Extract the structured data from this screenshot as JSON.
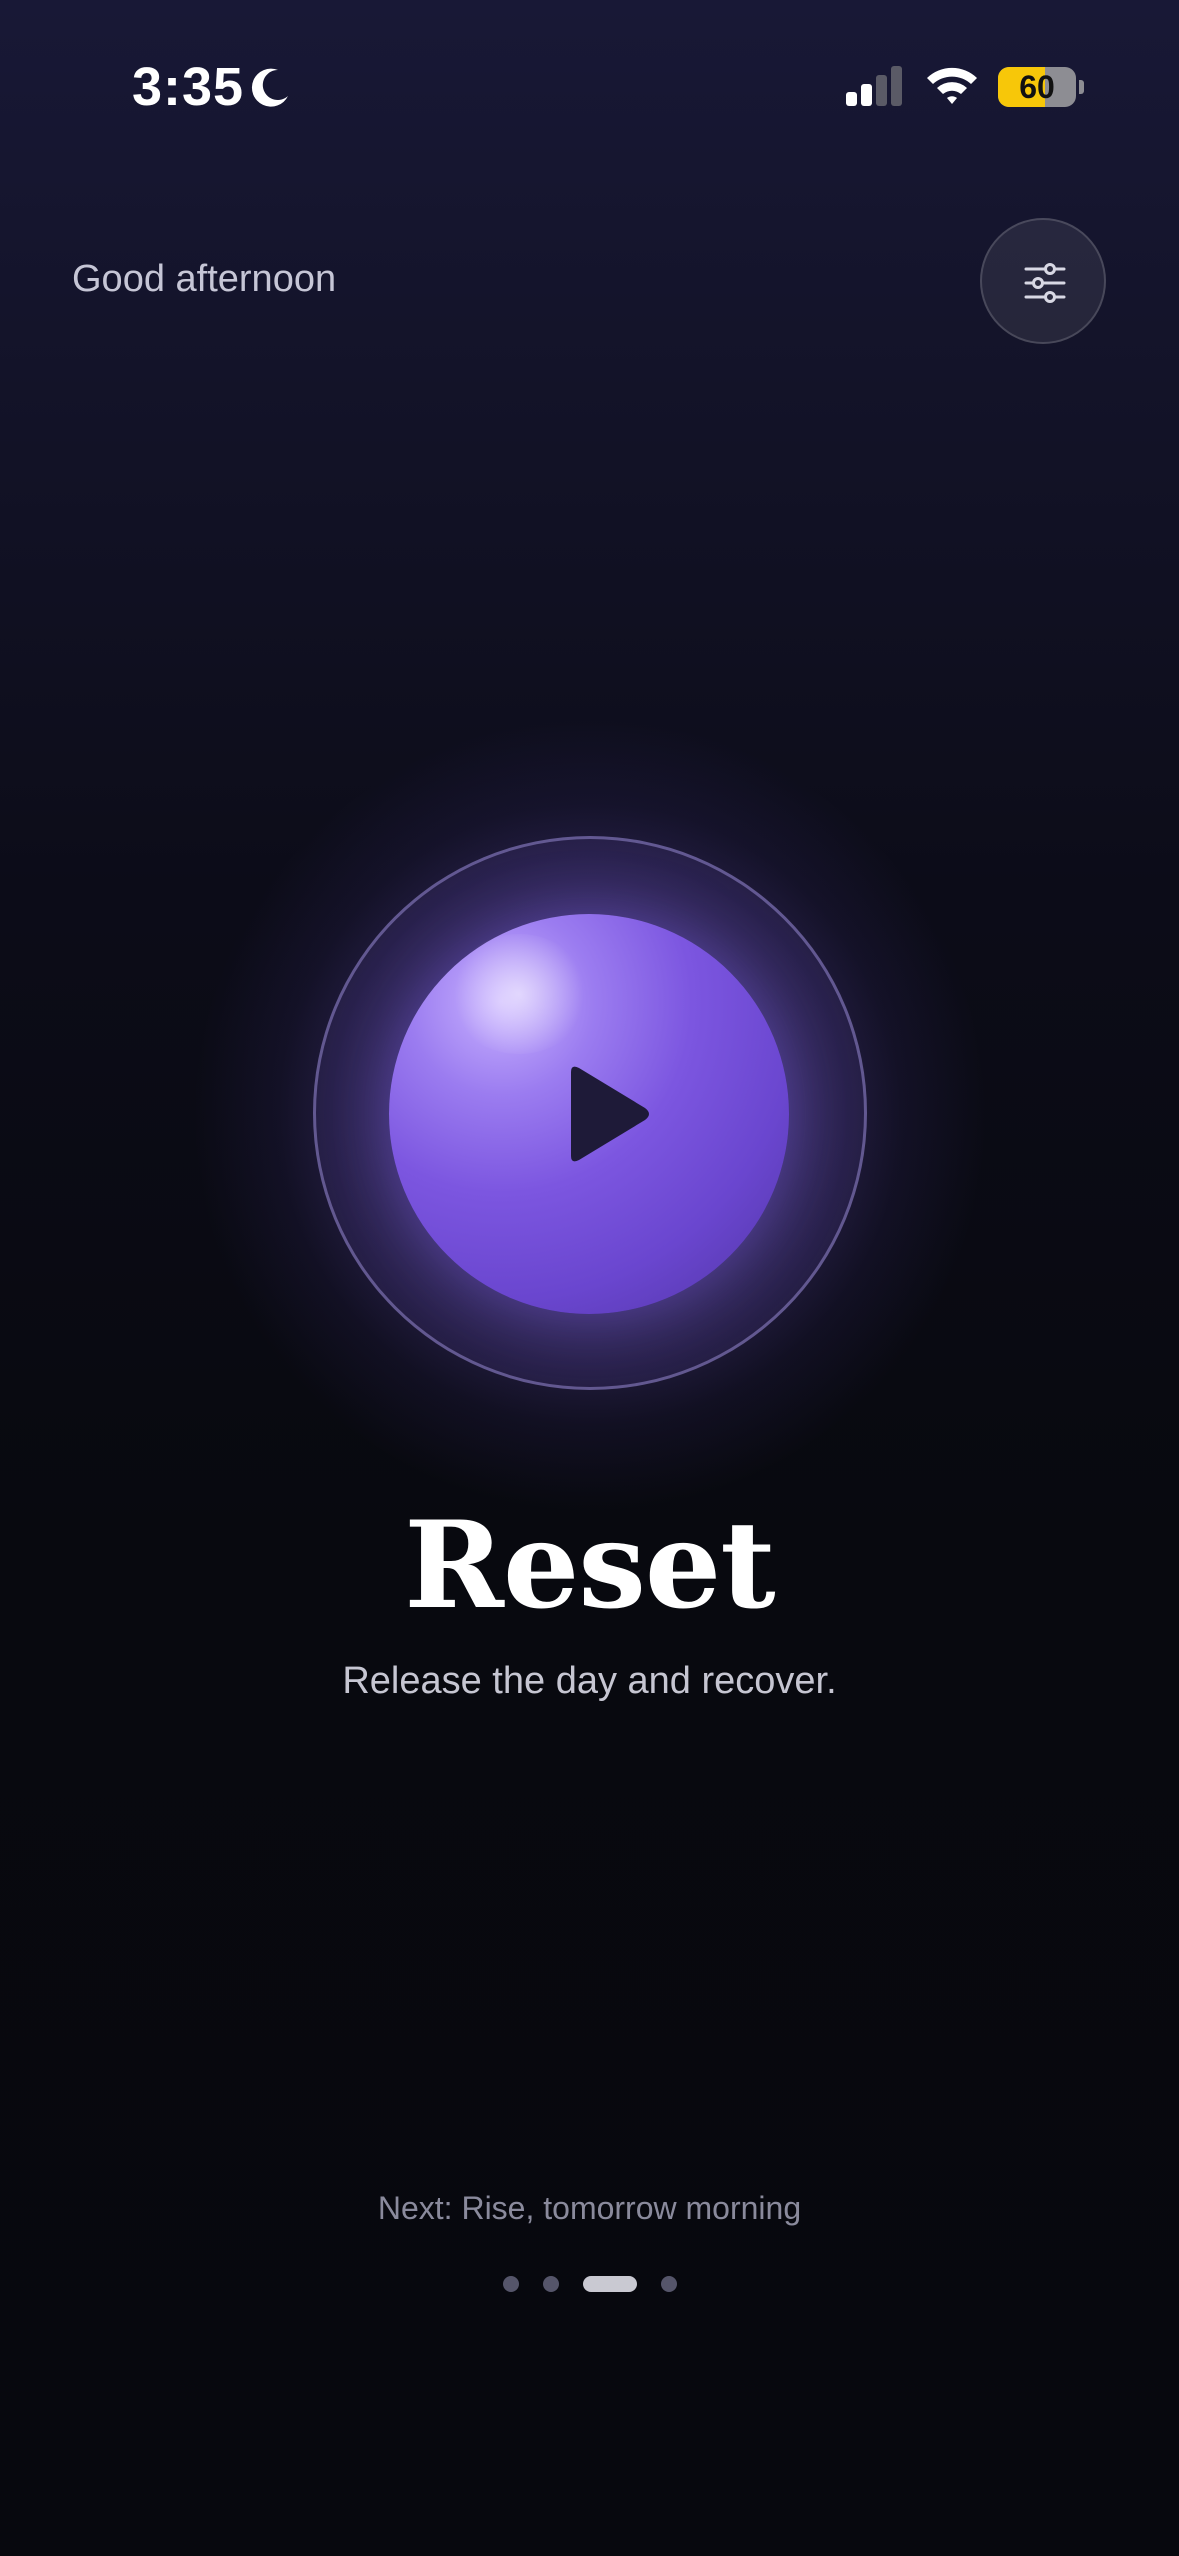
{
  "status_bar": {
    "time": "3:35",
    "battery_level": "60",
    "battery_fraction": 0.6,
    "icons": [
      "moon-icon",
      "cellular-signal-icon",
      "wifi-icon",
      "battery-icon"
    ]
  },
  "header": {
    "greeting": "Good afternoon",
    "settings_icon": "sliders-icon"
  },
  "session": {
    "title": "Reset",
    "subtitle": "Release the day and recover.",
    "play_icon": "play-icon",
    "accent_color": "#7c56e0"
  },
  "footer": {
    "next_label": "Next: Rise, tomorrow morning",
    "pagination": {
      "total": 4,
      "active_index": 2
    }
  }
}
